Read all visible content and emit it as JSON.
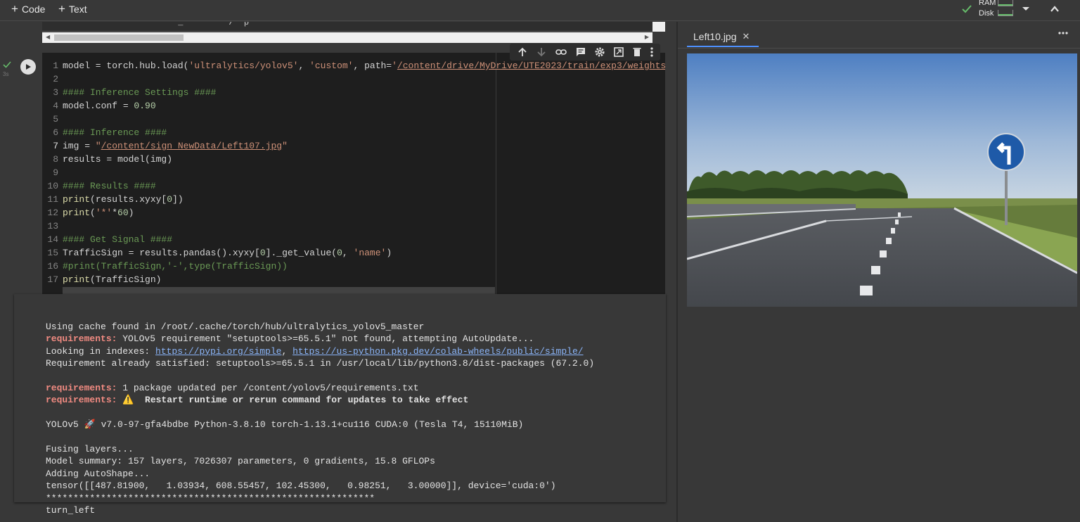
{
  "toolbar": {
    "add_code": "Code",
    "add_text": "Text",
    "ram_label": "RAM",
    "disk_label": "Disk"
  },
  "colors": {
    "background": "#383838",
    "editor_bg": "#1e1e1e",
    "accent": "#4d90fe",
    "ok_green": "#66bb6a",
    "requirements_red": "#f28b82",
    "link_blue": "#8ab4f8"
  },
  "cell": {
    "exec_time": "3s",
    "code_lines": [
      {
        "n": "1",
        "parts": [
          {
            "t": "model = torch.hub.load(",
            "c": "plain"
          },
          {
            "t": "'ultralytics/yolov5'",
            "c": "str"
          },
          {
            "t": ", ",
            "c": "plain"
          },
          {
            "t": "'custom'",
            "c": "str"
          },
          {
            "t": ", path=",
            "c": "plain"
          },
          {
            "t": "'",
            "c": "str"
          },
          {
            "t": "/content/drive/MyDrive/UTE2023/train/exp3/weights/",
            "c": "path"
          }
        ]
      },
      {
        "n": "2",
        "parts": []
      },
      {
        "n": "3",
        "parts": [
          {
            "t": "#### Inference Settings ####",
            "c": "cm"
          }
        ]
      },
      {
        "n": "4",
        "parts": [
          {
            "t": "model.conf = ",
            "c": "plain"
          },
          {
            "t": "0.90",
            "c": "num"
          }
        ]
      },
      {
        "n": "5",
        "parts": []
      },
      {
        "n": "6",
        "parts": [
          {
            "t": "#### Inference ####",
            "c": "cm"
          }
        ]
      },
      {
        "n": "7",
        "active": true,
        "parts": [
          {
            "t": "img = ",
            "c": "plain"
          },
          {
            "t": "\"",
            "c": "str"
          },
          {
            "t": "/content/sign_NewData/Left107.jpg",
            "c": "path"
          },
          {
            "t": "\"",
            "c": "str"
          }
        ]
      },
      {
        "n": "8",
        "parts": [
          {
            "t": "results = model(img)",
            "c": "plain"
          }
        ]
      },
      {
        "n": "9",
        "parts": []
      },
      {
        "n": "10",
        "parts": [
          {
            "t": "#### Results ####",
            "c": "cm"
          }
        ]
      },
      {
        "n": "11",
        "parts": [
          {
            "t": "print",
            "c": "kw"
          },
          {
            "t": "(results.xyxy[",
            "c": "plain"
          },
          {
            "t": "0",
            "c": "num"
          },
          {
            "t": "])",
            "c": "plain"
          }
        ]
      },
      {
        "n": "12",
        "parts": [
          {
            "t": "print",
            "c": "kw"
          },
          {
            "t": "(",
            "c": "plain"
          },
          {
            "t": "'*'",
            "c": "str"
          },
          {
            "t": "*",
            "c": "plain"
          },
          {
            "t": "60",
            "c": "num"
          },
          {
            "t": ")",
            "c": "plain"
          }
        ]
      },
      {
        "n": "13",
        "parts": []
      },
      {
        "n": "14",
        "parts": [
          {
            "t": "#### Get Signal ####",
            "c": "cm"
          }
        ]
      },
      {
        "n": "15",
        "parts": [
          {
            "t": "TrafficSign = results.pandas().xyxy[",
            "c": "plain"
          },
          {
            "t": "0",
            "c": "num"
          },
          {
            "t": "]._get_value(",
            "c": "plain"
          },
          {
            "t": "0",
            "c": "num"
          },
          {
            "t": ", ",
            "c": "plain"
          },
          {
            "t": "'name'",
            "c": "str"
          },
          {
            "t": ")",
            "c": "plain"
          }
        ]
      },
      {
        "n": "16",
        "parts": [
          {
            "t": "#print(TrafficSign,'-',type(TrafficSign))",
            "c": "cm"
          }
        ]
      },
      {
        "n": "17",
        "parts": [
          {
            "t": "print",
            "c": "kw"
          },
          {
            "t": "(TrafficSign)",
            "c": "plain"
          }
        ]
      }
    ],
    "output_lines": [
      [
        {
          "t": "Using cache found in /root/.cache/torch/hub/ultralytics_yolov5_master",
          "c": ""
        }
      ],
      [
        {
          "t": "requirements:",
          "c": "req"
        },
        {
          "t": " YOLOv5 requirement \"setuptools>=65.5.1\" not found, attempting AutoUpdate...",
          "c": ""
        }
      ],
      [
        {
          "t": "Looking in indexes: ",
          "c": ""
        },
        {
          "t": "https://pypi.org/simple",
          "c": "link"
        },
        {
          "t": ", ",
          "c": ""
        },
        {
          "t": "https://us-python.pkg.dev/colab-wheels/public/simple/",
          "c": "link"
        }
      ],
      [
        {
          "t": "Requirement already satisfied: setuptools>=65.5.1 in /usr/local/lib/python3.8/dist-packages (67.2.0)",
          "c": ""
        }
      ],
      [],
      [
        {
          "t": "requirements:",
          "c": "req"
        },
        {
          "t": " 1 package updated per /content/yolov5/requirements.txt",
          "c": ""
        }
      ],
      [
        {
          "t": "requirements:",
          "c": "req"
        },
        {
          "t": " ⚠️  Restart runtime or rerun command for updates to take effect",
          "c": "bold"
        }
      ],
      [],
      [
        {
          "t": "YOLOv5 🚀 v7.0-97-gfa4bdbe Python-3.8.10 torch-1.13.1+cu116 CUDA:0 (Tesla T4, 15110MiB)",
          "c": ""
        }
      ],
      [],
      [
        {
          "t": "Fusing layers...",
          "c": ""
        }
      ],
      [
        {
          "t": "Model summary: 157 layers, 7026307 parameters, 0 gradients, 15.8 GFLOPs",
          "c": ""
        }
      ],
      [
        {
          "t": "Adding AutoShape...",
          "c": ""
        }
      ],
      [
        {
          "t": "tensor([[487.81900,   1.03934, 608.55457, 102.45300,   0.98251,   3.00000]], device='cuda:0')",
          "c": ""
        }
      ],
      [
        {
          "t": "************************************************************",
          "c": ""
        }
      ],
      [
        {
          "t": "turn_left",
          "c": ""
        }
      ]
    ]
  },
  "panel": {
    "tab_title": "Left10.jpg"
  }
}
